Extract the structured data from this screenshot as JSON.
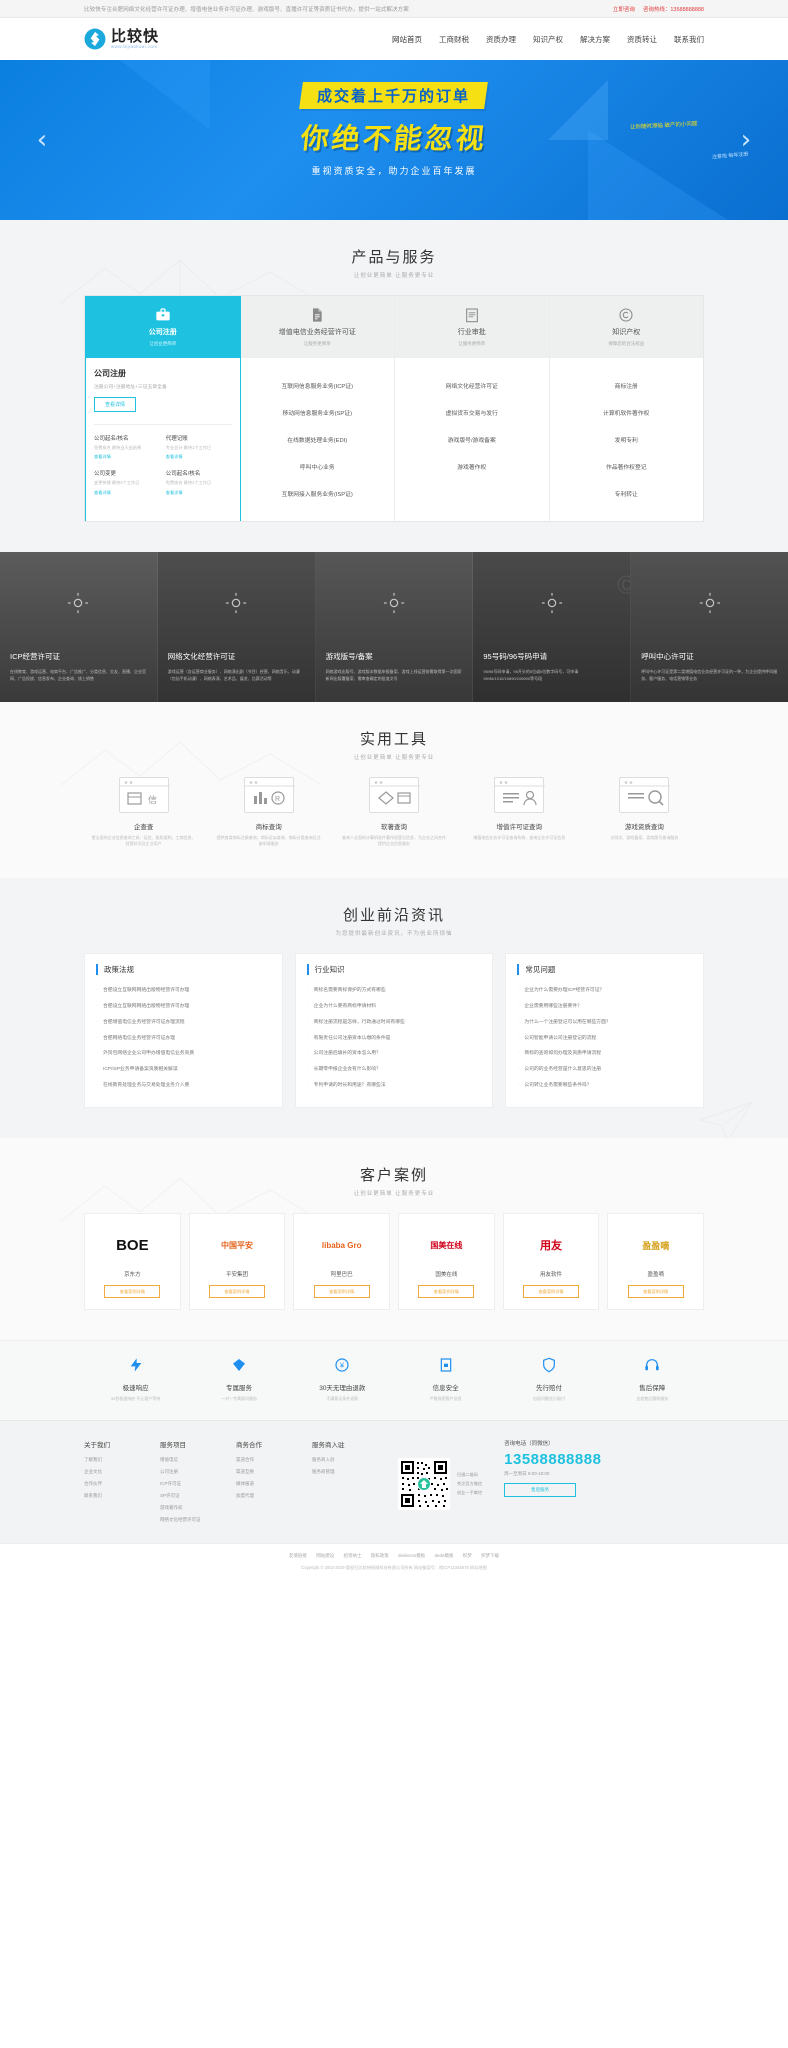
{
  "topbar": {
    "notice": "比较快专注合肥网络文化经营许可证办理、增值电信业务许可证办理、游戏版号、直播许可证等资质证书代办，提供一站式解决方案",
    "links": [
      "立即咨询",
      "咨询热线：13588888888"
    ]
  },
  "header": {
    "logo_cn": "比较快",
    "logo_url": "www.bijiaokuai.com",
    "nav": [
      "网站首页",
      "工商财税",
      "资质办理",
      "知识产权",
      "解决方案",
      "资质转让",
      "联系我们"
    ]
  },
  "hero": {
    "band": "成交着上千万的订单",
    "title": "你绝不能忽视",
    "subtitle": "重视资质安全，助力企业百年发展",
    "note": "让你随时濒临\n破产的小问题",
    "note2": "注意啦\n每年注册",
    "prev": "‹",
    "next": "›"
  },
  "products": {
    "title": "产品与服务",
    "subtitle": "让创业更简单 让服务更专业",
    "tabs": [
      {
        "label": "公司注册",
        "slogan": "让创业更简单",
        "icon": "briefcase-icon",
        "active": true
      },
      {
        "label": "增值电信业务经营许可证",
        "slogan": "让服务更简单",
        "icon": "document-icon",
        "active": false
      },
      {
        "label": "行业审批",
        "slogan": "让服务更简单",
        "icon": "clipboard-icon",
        "active": false
      },
      {
        "label": "知识产权",
        "slogan": "保障您的合法权益",
        "icon": "copyright-icon",
        "active": false
      }
    ],
    "lead": {
      "title": "公司注册",
      "desc": "注册公司+注册地址+三证五章全备",
      "button": "查看详情"
    },
    "mini": [
      {
        "title": "公司起名/核名",
        "desc": "免费核名\n最快当天出结果",
        "link": "查看详情"
      },
      {
        "title": "代理记账",
        "desc": "专业会计\n最快1个工作日",
        "link": "查看详情"
      },
      {
        "title": "公司变更",
        "desc": "变更快捷\n最快3个工作日",
        "link": "查看详情"
      },
      {
        "title": "公司起名/核名",
        "desc": "免费核名\n最快1个工作日",
        "link": "查看详情"
      }
    ],
    "lists": [
      [
        "互联网信息服务业务(ICP证)",
        "移动网信息服务业务(SP证)",
        "在线数据处理业务(EDI)",
        "呼叫中心业务",
        "互联网接入服务业务(ISP证)"
      ],
      [
        "网络文化经营许可证",
        "虚拟货币交易与发行",
        "游戏版号/游戏备案",
        "游戏著作权"
      ],
      [
        "商标注册",
        "计算机软件著作权",
        "发明专利",
        "作品著作权登记",
        "专利转让"
      ]
    ]
  },
  "strip": [
    {
      "title": "ICP经营许可证",
      "desc": "在线教育、游戏运营、电商平台、广告推广、分类信息、交友、直播、企业官网、广告投放、信息发布、企业查询、线上销售",
      "icon": "sun-icon"
    },
    {
      "title": "网络文化经营许可证",
      "desc": "游戏运营（含运营商业服务）、网络演出剧（节目）经营、网络音乐、动漫（包括手机动漫）、网络表演、艺术品、展览、比赛活动等",
      "icon": "sun-icon"
    },
    {
      "title": "游戏版号/备案",
      "desc": "网络游戏出版号、游戏版本数据申报备案、游戏上线运营前需取得第一次国家新闻出版署备案、需审查确定的批准文号",
      "icon": "sun-icon"
    },
    {
      "title": "95号码/96号码申请",
      "desc": "95/96号码申请，95开头的5位或6位数字码号，可申请95/96/1010/10690/106900等号段",
      "icon": "sun-icon"
    },
    {
      "title": "呼叫中心许可证",
      "desc": "呼叫中心许可证是第二类增值电信业务经营许可证的一种，为企业提供呼叫服务、客户服务、电话营销等业务",
      "icon": "sun-icon"
    }
  ],
  "tools": {
    "title": "实用工具",
    "subtitle": "让创业更简单 让服务更专业",
    "items": [
      {
        "name": "企查查",
        "desc": "更全面的企业信息查询工具：征信、股权架构、工商信息、经营状况及企业用户",
        "icon": "box-window-icon"
      },
      {
        "name": "商标查询",
        "desc": "提供各类商标注册查询、商标近似查询、商标分类查询及注册申请服务",
        "icon": "chart-window-icon"
      },
      {
        "name": "软著查询",
        "desc": "查询人全面的计算机软件著作权登记信息，为企业之间合作提供企业信息服务",
        "icon": "diamond-window-icon"
      },
      {
        "name": "增值许可证查询",
        "desc": "增值电信业务许可证查询系统，查询企业许可证信息",
        "icon": "user-window-icon"
      },
      {
        "name": "游戏资质查询",
        "desc": "文网文、游戏备案、游戏版号查询服务",
        "icon": "search-window-icon"
      }
    ]
  },
  "news": {
    "title": "创业前沿资讯",
    "subtitle": "为您提供最新创业资讯，不为创业所烦恼",
    "columns": [
      {
        "title": "政策法规",
        "items": [
          "合肥设立互联网网络出版物经营许可办理",
          "合肥设立互联网网络出版物经营许可办理",
          "合肥增值电信业务经营许可证办理流程",
          "合肥网络电信业务经营许可证办理",
          "外贸包网络企业公司申办增值电信业务资质",
          "ICP/ISP业务申请备案资质相关解读",
          "在线教育处理业务与交易处理业务介入要"
        ]
      },
      {
        "title": "行业知识",
        "items": [
          "商标名需要商标保护的方式有哪些",
          "企业为什么要有商标申请材料",
          "商标注册流程是怎样，行政通过时间有哪些",
          "有限责任公司注册资本认缴的条件是",
          "公司注册后填补的资本怎么用？",
          "长期零申报企业会有什么影响？",
          "专利申请的时长和用途？有哪些法"
        ]
      },
      {
        "title": "常见问题",
        "items": [
          "企业为什么需要办理ICP经营许可证？",
          "企业需要用哪些注册要件？",
          "为什么一个注册登记可以用在哪些方面？",
          "公司智能申请公司注册登记的流程",
          "商标的查询如何办理及资质申请流程",
          "公司的的业务经营是什么意思的注册",
          "公司转让业务需要哪些条件吗？"
        ]
      }
    ]
  },
  "cases": {
    "title": "客户案例",
    "subtitle": "让创业更简单 让服务更专业",
    "items": [
      {
        "logo": "BOE",
        "logo_color": "#111",
        "name": "京东方",
        "button": "查看案例详情"
      },
      {
        "logo": "中国平安",
        "logo_color": "#e6631c",
        "name": "平安集团",
        "button": "查看案例详情"
      },
      {
        "logo": "libaba Gro",
        "logo_color": "#e6631c",
        "name": "阿里巴巴",
        "button": "查看案例详情"
      },
      {
        "logo": "国美在线",
        "logo_color": "#d0021b",
        "name": "国美在线",
        "button": "查看案例详情"
      },
      {
        "logo": "用友",
        "logo_color": "#d0021b",
        "name": "用友软件",
        "button": "查看案例详情"
      },
      {
        "logo": "盈盈嘀",
        "logo_color": "#d4a017",
        "name": "盈盈嘀",
        "button": "查看案例详情"
      }
    ]
  },
  "trust": [
    {
      "title": "极速响应",
      "desc": "30秒极速响应 不让客户等待",
      "icon": "lightning-icon"
    },
    {
      "title": "专属服务",
      "desc": "一对一专属顾问服务",
      "icon": "diamond-icon"
    },
    {
      "title": "30天无理由退款",
      "desc": "不满意无条件退款",
      "icon": "refund-icon"
    },
    {
      "title": "信息安全",
      "desc": "严格保密客户信息",
      "icon": "file-lock-icon"
    },
    {
      "title": "先行赔付",
      "desc": "出现问题先行赔付",
      "icon": "shield-icon"
    },
    {
      "title": "售后保障",
      "desc": "全程售后跟踪服务",
      "icon": "headset-icon"
    }
  ],
  "footer": {
    "columns": [
      {
        "title": "关于我们",
        "links": [
          "了解我们",
          "企业文化",
          "合作伙伴",
          "联系我们"
        ]
      },
      {
        "title": "服务项目",
        "links": [
          "增值电信",
          "公司注册",
          "ICP许可证",
          "SP许可证",
          "游戏著作权",
          "网络文化经营许可证"
        ]
      },
      {
        "title": "商务合作",
        "links": [
          "渠道合作",
          "渠道互换",
          "媒体报道",
          "加盟代理"
        ]
      },
      {
        "title": "服务商入驻",
        "links": [
          "服务商入驻",
          "服务商管理"
        ]
      }
    ],
    "qr": {
      "lines": [
        "扫描二维码",
        "关注官方微信",
        "创业一手掌控"
      ]
    },
    "contact": {
      "label": "咨询电话（同微信）",
      "phone": "13588888888",
      "hours": "周一至周日 9:00-18:00",
      "button": "售后服务"
    },
    "copy_links": [
      "友情链接",
      "网站建设",
      "招贤纳士",
      "隐私政策",
      "dedecms模板",
      "dede模板",
      "织梦",
      "织梦下载"
    ],
    "copy_text": "Copyright © 2002-2019 版权归比较快网络科技有限公司所有   网站备案号：皖ICP12345678   网站地图"
  }
}
